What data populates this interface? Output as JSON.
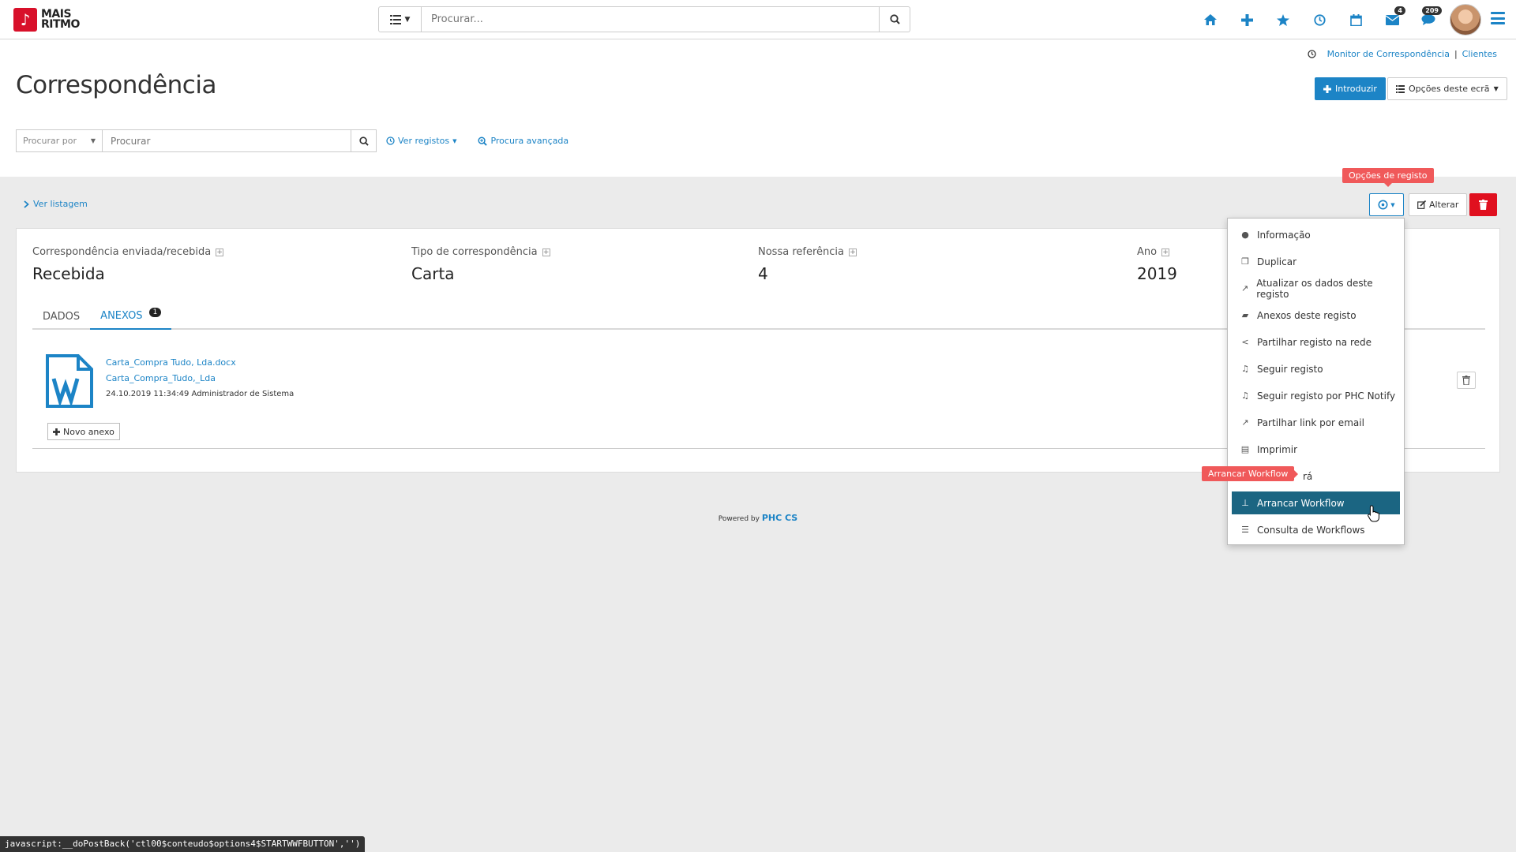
{
  "app": {
    "logo_line1": "MAIS",
    "logo_line2": "RITMO",
    "logo_mark": "♪"
  },
  "global_search": {
    "placeholder": "Procurar..."
  },
  "top_nav": {
    "mail_badge": "4",
    "notif_badge": "209"
  },
  "breadcrumb": {
    "item1": "Monitor de Correspondência",
    "separator": "|",
    "item2": "Clientes"
  },
  "page_title": "Correspondência",
  "header_buttons": {
    "introduzir": "Introduzir",
    "opcoes": "Opções deste ecrã"
  },
  "search": {
    "procurar_por": "Procurar por",
    "placeholder": "Procurar",
    "ver_registos": "Ver registos",
    "procura_avancada": "Procura avançada"
  },
  "record_bar": {
    "ver_listagem": "Ver listagem",
    "alterar": "Alterar",
    "tooltip_opcoes": "Opções de registo"
  },
  "fields": [
    {
      "label": "Correspondência enviada/recebida",
      "value": "Recebida"
    },
    {
      "label": "Tipo de correspondência",
      "value": "Carta"
    },
    {
      "label": "Nossa referência",
      "value": "4"
    },
    {
      "label": "Ano",
      "value": "2019"
    }
  ],
  "tabs": [
    {
      "label": "DADOS"
    },
    {
      "label": "ANEXOS",
      "badge": "1"
    }
  ],
  "attachment": {
    "filename": "Carta_Compra Tudo, Lda.docx",
    "title": "Carta_Compra_Tudo,_Lda",
    "meta": "24.10.2019 11:34:49 Administrador de Sistema",
    "novo_anexo": "Novo anexo"
  },
  "dropdown": {
    "items": [
      {
        "label": "Informação",
        "icon": "info-icon"
      },
      {
        "label": "Duplicar",
        "icon": "copy-icon"
      },
      {
        "label": "Atualizar os dados deste registo",
        "icon": "refresh-icon"
      },
      {
        "label": "Anexos deste registo",
        "icon": "folder-icon"
      },
      {
        "label": "Partilhar registo na rede",
        "icon": "share-icon"
      },
      {
        "label": "Seguir registo",
        "icon": "bell-icon"
      },
      {
        "label": "Seguir registo por PHC Notify",
        "icon": "bell-icon"
      },
      {
        "label": "Partilhar link por email",
        "icon": "external-link-icon"
      },
      {
        "label": "Imprimir",
        "icon": "print-icon"
      },
      {
        "label": "rá",
        "icon": ""
      },
      {
        "label": "Arrancar Workflow",
        "icon": "sitemap-icon",
        "highlighted": true
      },
      {
        "label": "Consulta de Workflows",
        "icon": "list-icon"
      }
    ],
    "tooltip_workflow": "Arrancar Workflow"
  },
  "footer": {
    "powered_by": "Powered by",
    "brand": "PHC CS"
  },
  "status_bar": "javascript:__doPostBack('ctl00$conteudo$options4$STARTWWFBUTTON','')",
  "colors": {
    "accent": "#1c84c6",
    "danger": "#e0101f",
    "highlight": "#1b6582",
    "tooltip": "#f0595a"
  }
}
